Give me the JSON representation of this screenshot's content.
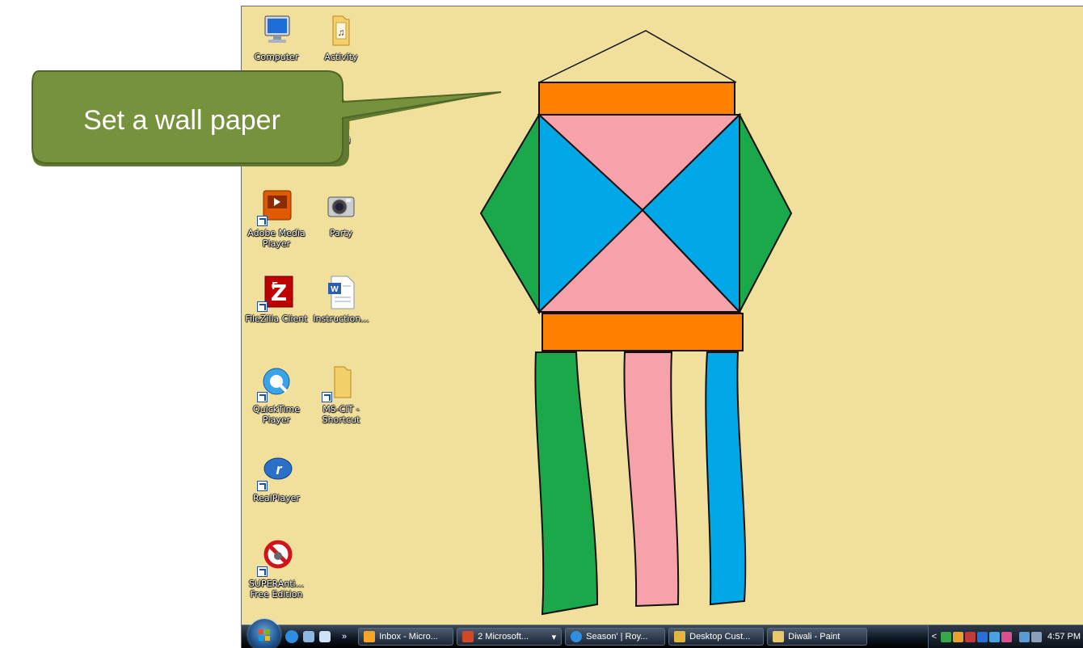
{
  "callout": {
    "text": "Set a wall paper"
  },
  "desktop": {
    "icons": [
      {
        "label": "Computer"
      },
      {
        "label": "Activity"
      },
      {
        "label": "ABU"
      },
      {
        "label": "Adobe Media Player"
      },
      {
        "label": "Party"
      },
      {
        "label": "FileZilla Client"
      },
      {
        "label": "Instruction..."
      },
      {
        "label": "QuickTime Player"
      },
      {
        "label": "MS-CIT - Shortcut"
      },
      {
        "label": "RealPlayer"
      },
      {
        "label": "SUPERAnti... Free Edition"
      }
    ]
  },
  "taskbar": {
    "overflow_label": "»",
    "buttons": [
      {
        "label": "Inbox - Micro..."
      },
      {
        "label": "2 Microsoft..."
      },
      {
        "label": "Season' | Roy..."
      },
      {
        "label": "Desktop Cust..."
      },
      {
        "label": "Diwali - Paint"
      }
    ],
    "dropdown_arrow": "▾",
    "tray_expand": "<",
    "clock": "4:57 PM"
  },
  "colors": {
    "wallpaper_bg": "#f1e09b",
    "lantern_orange": "#ff7f00",
    "lantern_pink": "#f7a1aa",
    "lantern_blue": "#00a8e8",
    "lantern_green": "#1aa84a",
    "callout_fill": "#76923c"
  }
}
